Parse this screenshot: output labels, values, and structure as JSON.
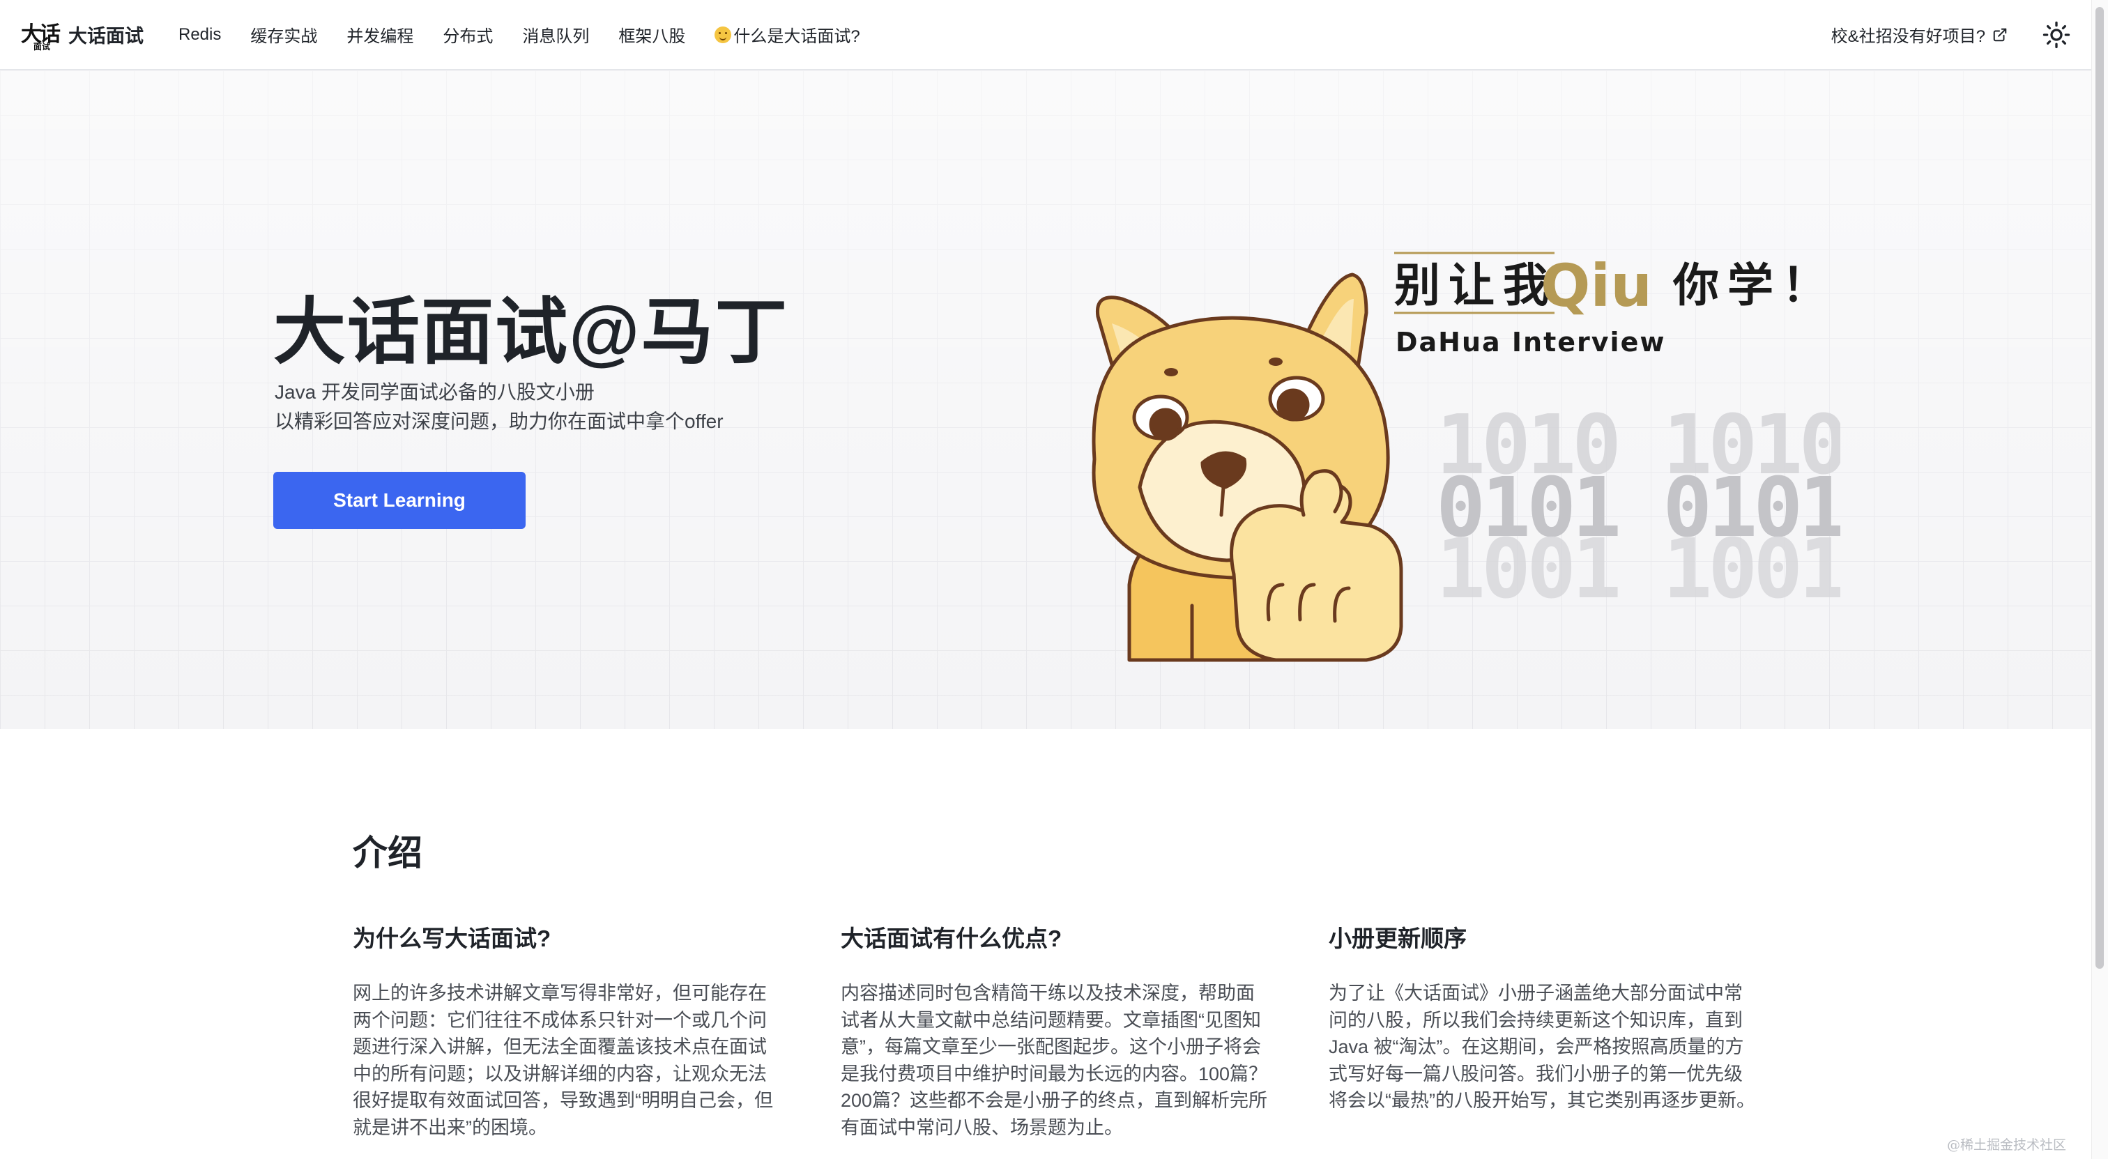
{
  "nav": {
    "brand_logo_text": "大话",
    "brand_logo_sub": "面试",
    "brand_title": "大话面试",
    "links": [
      "Redis",
      "缓存实战",
      "并发编程",
      "分布式",
      "消息队列",
      "框架八股",
      "什么是大话面试?"
    ],
    "external_link": "校&社招没有好项目?"
  },
  "hero": {
    "title": "大话面试@马丁",
    "tagline1": "Java 开发同学面试必备的八股文小册",
    "tagline2": "以精彩回答应对深度问题，助力你在面试中拿个offer",
    "cta_label": "Start Learning",
    "art": {
      "slogan_part1": "别让我",
      "slogan_highlight": "Qiu",
      "slogan_part2": "你学！",
      "subtitle": "DaHua Interview",
      "binary_rows": [
        "1010 1010",
        "0101 0101",
        "1001 1001"
      ]
    }
  },
  "intro": {
    "title": "介绍",
    "features": [
      {
        "title": "为什么写大话面试?",
        "text": "网上的许多技术讲解文章写得非常好，但可能存在两个问题：它们往往不成体系只针对一个或几个问题进行深入讲解，但无法全面覆盖该技术点在面试中的所有问题；以及讲解详细的内容，让观众无法很好提取有效面试回答，导致遇到“明明自己会，但就是讲不出来”的困境。"
      },
      {
        "title": "大话面试有什么优点?",
        "text": "内容描述同时包含精简干练以及技术深度，帮助面试者从大量文献中总结问题精要。文章插图“见图知意”，每篇文章至少一张配图起步。这个小册子将会是我付费项目中维护时间最为长远的内容。100篇？200篇？这些都不会是小册子的终点，直到解析完所有面试中常问八股、场景题为止。"
      },
      {
        "title": "小册更新顺序",
        "text": "为了让《大话面试》小册子涵盖绝大部分面试中常问的八股，所以我们会持续更新这个知识库，直到 Java 被“淘汰”。在这期间，会严格按照高质量的方式写好每一篇八股问答。我们小册子的第一优先级将会以“最热”的八股开始写，其它类别再逐步更新。"
      }
    ]
  },
  "watermark": "@稀土掘金技术社区",
  "colors": {
    "accent": "#3b66f0",
    "mascot": "#f7d27a",
    "slogan_gold": "#b59a55"
  }
}
